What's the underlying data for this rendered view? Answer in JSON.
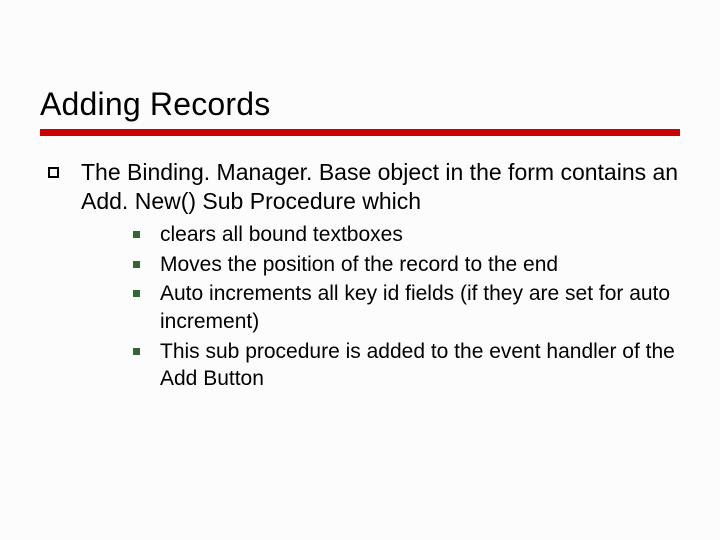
{
  "slide": {
    "title": "Adding Records",
    "points": [
      {
        "text": "The Binding. Manager. Base object in the form contains an Add. New() Sub Procedure which",
        "sub": [
          "clears all bound textboxes",
          "Moves the position of the record to the end",
          "Auto increments all key id fields (if they are set for auto increment)",
          "This sub procedure is added to the event handler of the Add Button"
        ]
      }
    ]
  }
}
